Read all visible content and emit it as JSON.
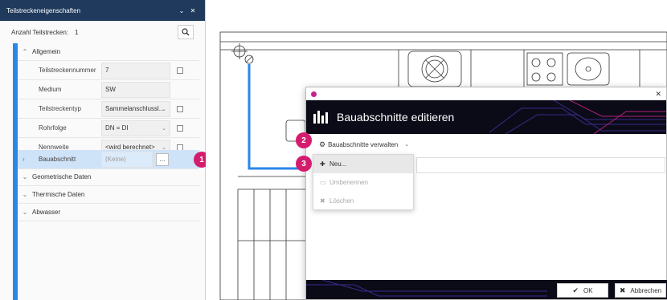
{
  "panel": {
    "title": "Teilstreckeneigenschaften",
    "count_label": "Anzahl Teilstrecken:",
    "count_value": "1",
    "groups": {
      "general": "Allgemein",
      "geometric": "Geometrische Daten",
      "thermal": "Thermische Daten",
      "waste": "Abwasser"
    },
    "props": [
      {
        "name": "Teilstreckennummer",
        "value": "7"
      },
      {
        "name": "Medium",
        "value": "SW"
      },
      {
        "name": "Teilstreckentyp",
        "value": "Sammelanschlussl..."
      },
      {
        "name": "Rohrfolge",
        "value": "DN = DI"
      },
      {
        "name": "Nennweite",
        "value": "<wird berechnet>"
      },
      {
        "name": "Bauabschnitt",
        "value": "(Keine)",
        "button": "..."
      }
    ]
  },
  "badges": [
    "1",
    "2",
    "3"
  ],
  "dialog": {
    "title": "Bauabschnitte editieren",
    "manage_label": "Bauabschnitte verwalten",
    "menu": [
      {
        "label": "Neu...",
        "icon": "plus-icon",
        "disabled": false
      },
      {
        "label": "Umbenennen",
        "icon": "rename-icon",
        "disabled": true
      },
      {
        "label": "Löschen",
        "icon": "delete-icon",
        "disabled": true
      }
    ],
    "ok_label": "OK",
    "cancel_label": "Abbrechen"
  },
  "colors": {
    "accent": "#2a86e8",
    "badge": "#d41c6e",
    "header_bg": "#0b0b18",
    "panel_title_bg": "#1f3a5c"
  }
}
